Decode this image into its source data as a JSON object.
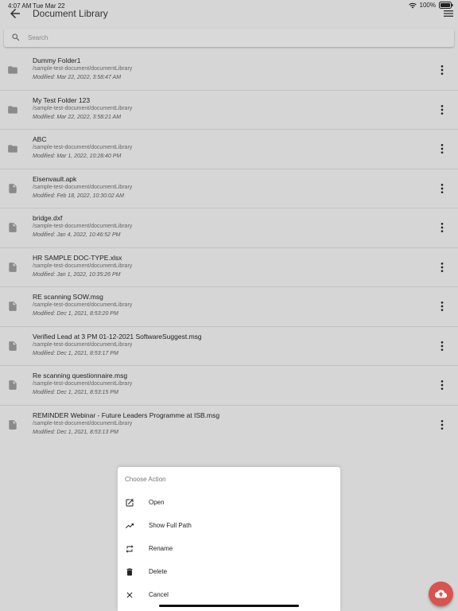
{
  "status_bar": {
    "time": "4:07 AM",
    "date": "Tue Mar 22",
    "battery": "100%"
  },
  "app_bar": {
    "title": "Document Library"
  },
  "search": {
    "placeholder": "Search",
    "value": ""
  },
  "items": [
    {
      "name": "Dummy Folder1",
      "path": "/sample-test-document/documentLibrary",
      "modified": "Modified: Mar 22, 2022, 3:58:47 AM",
      "icon": "folder-icon"
    },
    {
      "name": "My Test Folder 123",
      "path": "/sample-test-document/documentLibrary",
      "modified": "Modified: Mar 22, 2022, 3:58:21 AM",
      "icon": "folder-icon"
    },
    {
      "name": "ABC",
      "path": "/sample-test-document/documentLibrary",
      "modified": "Modified: Mar 1, 2022, 10:28:40 PM",
      "icon": "folder-icon"
    },
    {
      "name": "Eisenvault.apk",
      "path": "/sample-test-document/documentLibrary",
      "modified": "Modified: Feb 18, 2022, 10:30:02 AM",
      "icon": "file-icon"
    },
    {
      "name": "bridge.dxf",
      "path": "/sample-test-document/documentLibrary",
      "modified": "Modified: Jan 4, 2022, 10:46:52 PM",
      "icon": "file-icon"
    },
    {
      "name": "HR SAMPLE DOC-TYPE.xlsx",
      "path": "/sample-test-document/documentLibrary",
      "modified": "Modified: Jan 1, 2022, 10:35:26 PM",
      "icon": "file-icon"
    },
    {
      "name": "RE scanning SOW.msg",
      "path": "/sample-test-document/documentLibrary",
      "modified": "Modified: Dec 1, 2021, 8:53:20 PM",
      "icon": "file-icon"
    },
    {
      "name": "Verified Lead at 3 PM 01-12-2021 SoftwareSuggest.msg",
      "path": "/sample-test-document/documentLibrary",
      "modified": "Modified: Dec 1, 2021, 8:53:17 PM",
      "icon": "file-icon"
    },
    {
      "name": "Re scanning questionnaire.msg",
      "path": "/sample-test-document/documentLibrary",
      "modified": "Modified: Dec 1, 2021, 8:53:15 PM",
      "icon": "file-icon"
    },
    {
      "name": "REMINDER Webinar - Future Leaders Programme at ISB.msg",
      "path": "/sample-test-document/documentLibrary",
      "modified": "Modified: Dec 1, 2021, 8:53:13 PM",
      "icon": "file-icon"
    }
  ],
  "action_sheet": {
    "title": "Choose Action",
    "actions": [
      {
        "label": "Open",
        "icon": "open-external-icon"
      },
      {
        "label": "Show Full Path",
        "icon": "trending-up-icon"
      },
      {
        "label": "Rename",
        "icon": "repeat-icon"
      },
      {
        "label": "Delete",
        "icon": "trash-icon"
      },
      {
        "label": "Cancel",
        "icon": "close-icon"
      }
    ]
  },
  "colors": {
    "overlay_bg": "#d6d6d6",
    "fab": "#d9534f",
    "sheet_bg": "#ffffff"
  }
}
